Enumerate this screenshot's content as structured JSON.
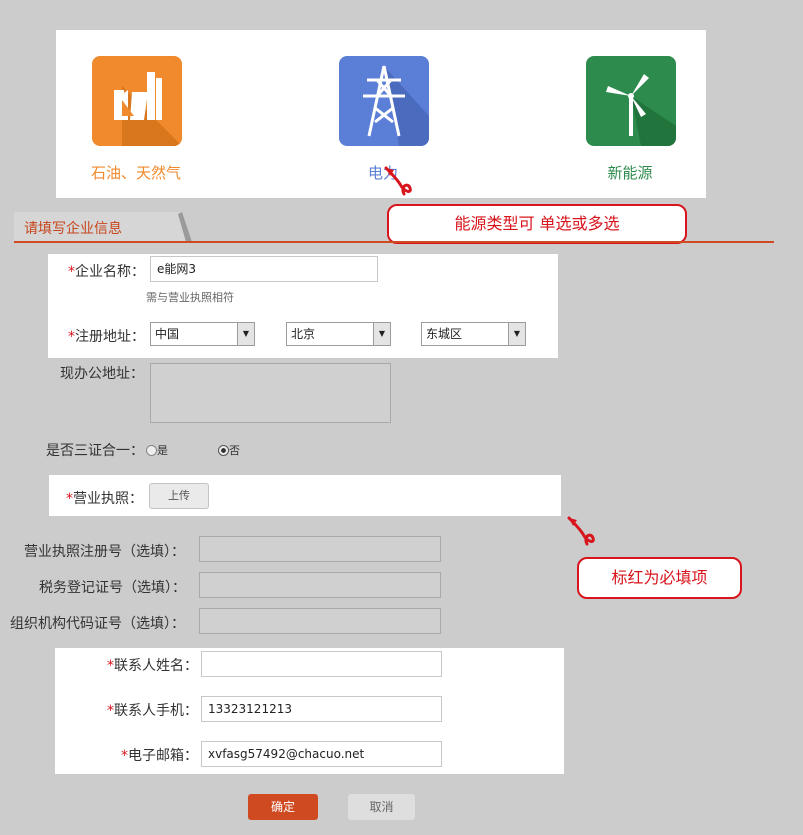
{
  "energy_types": {
    "items": [
      {
        "label": "石油、天然气",
        "color": "#f08a2c",
        "icon": "factory-icon"
      },
      {
        "label": "电力",
        "color": "#5b7fd6",
        "icon": "power-tower-icon"
      },
      {
        "label": "新能源",
        "color": "#2e8b4e",
        "icon": "wind-turbine-icon"
      }
    ]
  },
  "section": {
    "title": "请填写企业信息"
  },
  "callouts": {
    "energy_type": "能源类型可 单选或多选",
    "required": "标红为必填项"
  },
  "form": {
    "company_name": {
      "label": "企业名称：",
      "value": "e能网3",
      "hint": "需与营业执照相符"
    },
    "reg_address": {
      "label": "注册地址：",
      "country": "中国",
      "province": "北京",
      "district": "东城区"
    },
    "office_address": {
      "label": "现办公地址：",
      "value": ""
    },
    "three_in_one": {
      "label": "是否三证合一：",
      "options": [
        "是",
        "否"
      ],
      "selected": "否"
    },
    "license": {
      "label": "营业执照：",
      "button": "上传"
    },
    "license_no": {
      "label": "营业执照注册号（选填）：",
      "value": ""
    },
    "tax_no": {
      "label": "税务登记证号（选填）：",
      "value": ""
    },
    "org_code": {
      "label": "组织机构代码证号（选填）：",
      "value": ""
    },
    "contact_name": {
      "label": "联系人姓名：",
      "value": ""
    },
    "contact_phone": {
      "label": "联系人手机：",
      "value": "13323121213"
    },
    "email": {
      "label": "电子邮箱：",
      "value": "xvfasg57492@chacuo.net"
    },
    "required_mark": "*"
  },
  "actions": {
    "confirm": "确定",
    "cancel": "取消"
  },
  "colors": {
    "accent": "#d04a21",
    "callout_red": "#d8141c",
    "page_bg": "#cccccc"
  }
}
